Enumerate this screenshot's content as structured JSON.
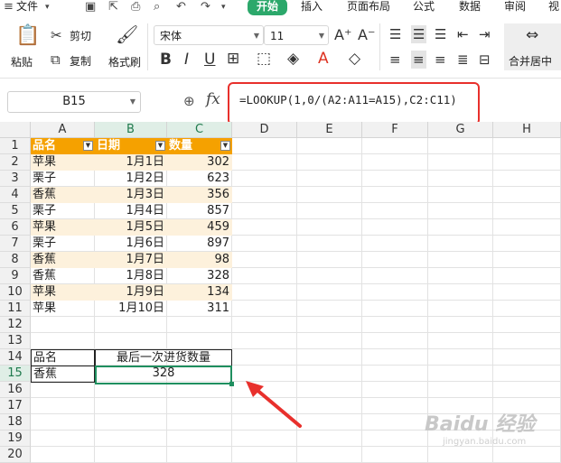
{
  "ribbon": {
    "tabs": [
      "文件",
      "开始",
      "插入",
      "页面布局",
      "公式",
      "数据",
      "审阅",
      "视"
    ],
    "active_tab": "开始",
    "clipboard": {
      "paste": "粘贴",
      "cut": "剪切",
      "copy": "复制",
      "format_painter": "格式刷"
    },
    "font_name": "宋体",
    "font_size": "11",
    "merge_center": "合并居中"
  },
  "formula_bar": {
    "name_box": "B15",
    "fx_label": "fx",
    "formula": "=LOOKUP(1,0/(A2:A11=A15),C2:C11)"
  },
  "columns": [
    "A",
    "B",
    "C",
    "D",
    "E",
    "F",
    "G",
    "H"
  ],
  "rows": [
    "1",
    "2",
    "3",
    "4",
    "5",
    "6",
    "7",
    "8",
    "9",
    "10",
    "11",
    "12",
    "13",
    "14",
    "15",
    "16",
    "17",
    "18",
    "19",
    "20"
  ],
  "table": {
    "headers": [
      "品名",
      "日期",
      "数量"
    ],
    "rows": [
      {
        "name": "苹果",
        "date": "1月1日",
        "qty": "302"
      },
      {
        "name": "栗子",
        "date": "1月2日",
        "qty": "623"
      },
      {
        "name": "香蕉",
        "date": "1月3日",
        "qty": "356"
      },
      {
        "name": "栗子",
        "date": "1月4日",
        "qty": "857"
      },
      {
        "name": "苹果",
        "date": "1月5日",
        "qty": "459"
      },
      {
        "name": "栗子",
        "date": "1月6日",
        "qty": "897"
      },
      {
        "name": "香蕉",
        "date": "1月7日",
        "qty": "98"
      },
      {
        "name": "香蕉",
        "date": "1月8日",
        "qty": "328"
      },
      {
        "name": "苹果",
        "date": "1月9日",
        "qty": "134"
      },
      {
        "name": "苹果",
        "date": "1月10日",
        "qty": "311"
      }
    ]
  },
  "lookup": {
    "label_name": "品名",
    "label_result": "最后一次进货数量",
    "name_value": "香蕉",
    "result_value": "328"
  },
  "colors": {
    "header": "#f5a100",
    "accent": "#2ca86b",
    "highlight": "#e8302c"
  },
  "watermark": "Baidu 经验",
  "watermark_sub": "jingyan.baidu.com"
}
